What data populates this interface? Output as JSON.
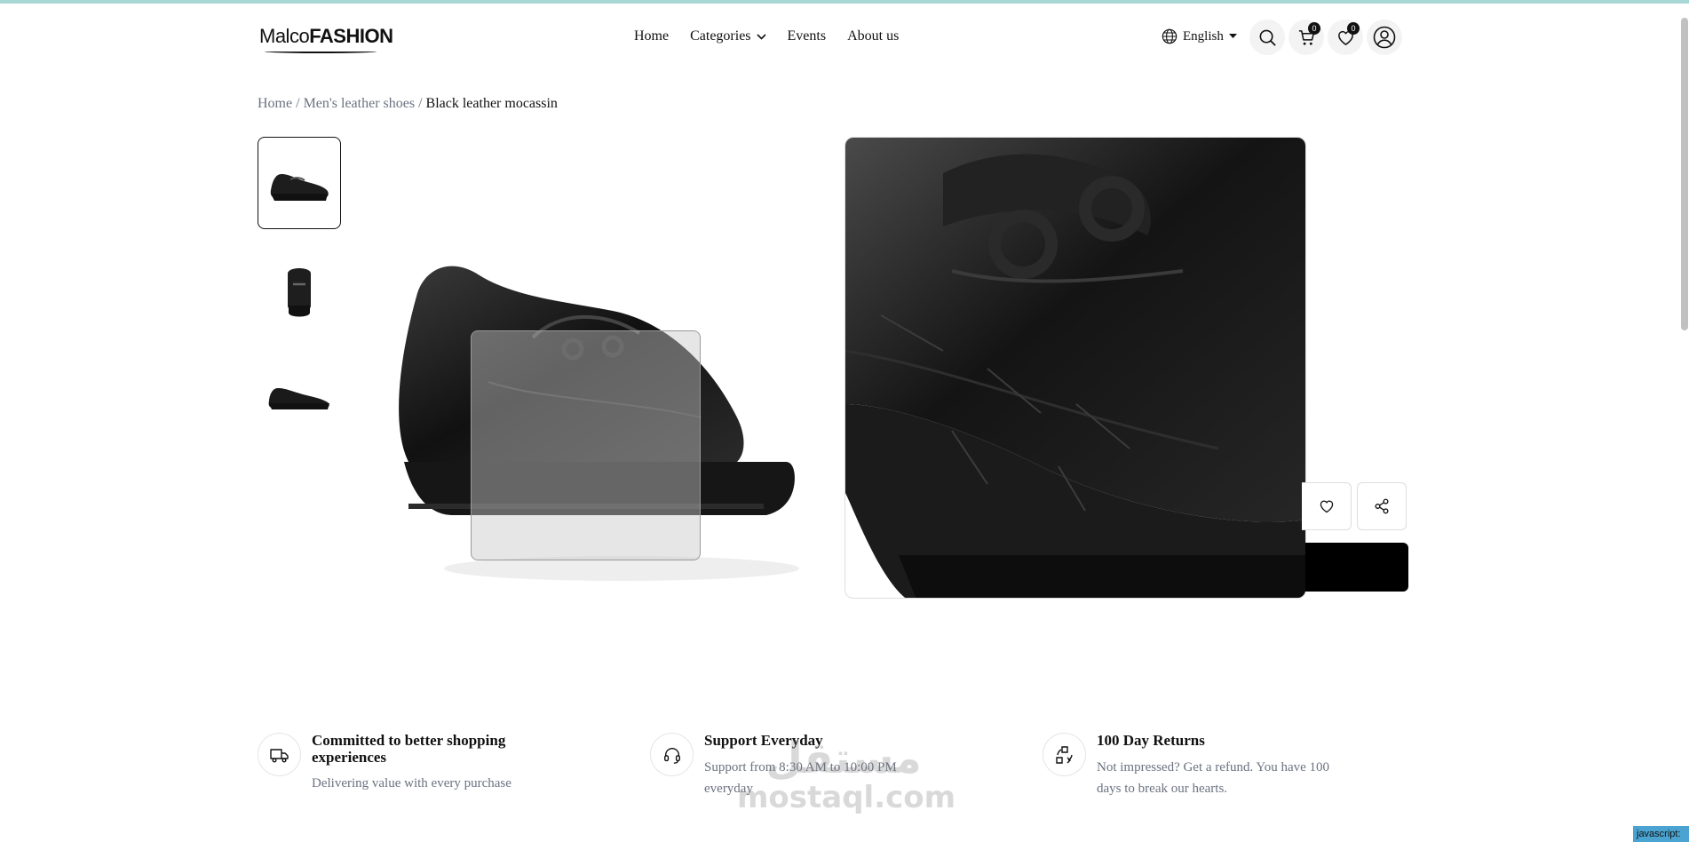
{
  "brand": {
    "logo_part1": "Malco",
    "logo_part2": "FASHION"
  },
  "nav": {
    "home": "Home",
    "categories": "Categories",
    "events": "Events",
    "about": "About us"
  },
  "language": {
    "label": "English"
  },
  "header": {
    "cart_count": "0",
    "wishlist_count": "0"
  },
  "breadcrumb": {
    "home": "Home",
    "category": "Men's leather shoes",
    "current": "Black leather mocassin"
  },
  "features": [
    {
      "title": "Committed to better shopping experiences",
      "desc": "Delivering value with every purchase"
    },
    {
      "title": "Support Everyday",
      "desc": "Support from 8:30 AM to 10:00 PM everyday"
    },
    {
      "title": "100 Day Returns",
      "desc": "Not impressed? Get a refund. You have 100 days to break our hearts."
    }
  ],
  "watermark": {
    "arabic": "مستقل",
    "latin": "mostaql.com"
  },
  "status": {
    "js_tag": "javascript:"
  },
  "colors": {
    "accent_top": "#a7d8d6",
    "primary": "#000000",
    "muted": "#6b7280"
  }
}
